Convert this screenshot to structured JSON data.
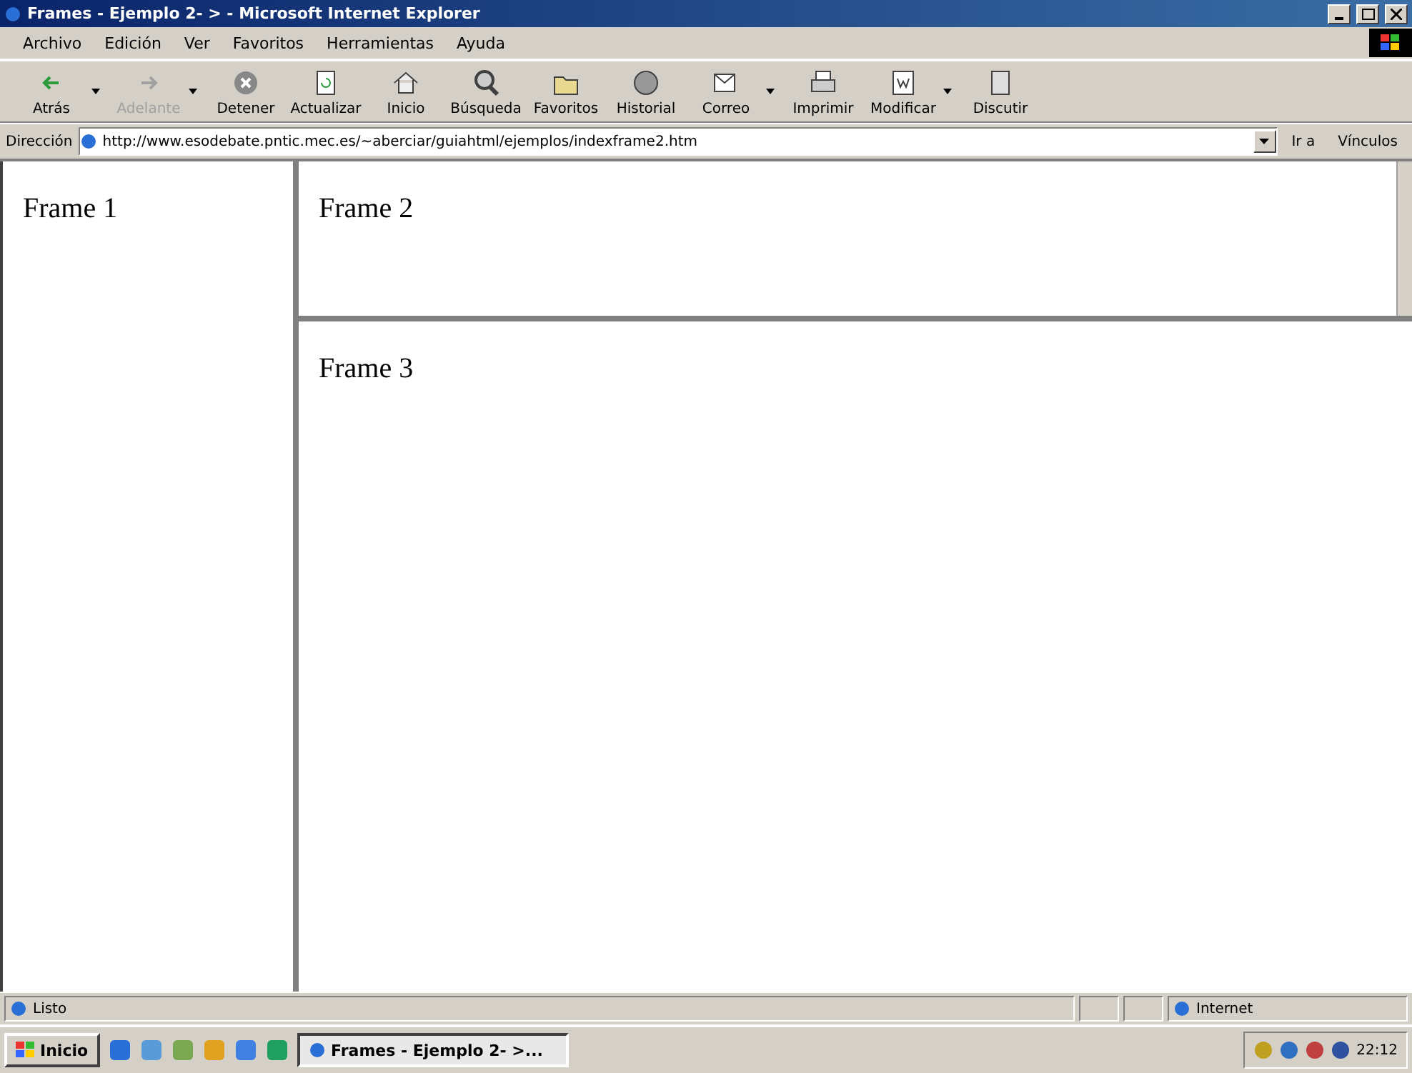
{
  "window": {
    "title": "Frames - Ejemplo 2- > - Microsoft Internet Explorer"
  },
  "menu": [
    "Archivo",
    "Edición",
    "Ver",
    "Favoritos",
    "Herramientas",
    "Ayuda"
  ],
  "toolbar": [
    {
      "label": "Atrás",
      "kind": "back",
      "disabled": false,
      "dropdown": true
    },
    {
      "label": "Adelante",
      "kind": "forward",
      "disabled": true,
      "dropdown": true
    },
    {
      "label": "Detener",
      "kind": "stop",
      "disabled": false,
      "dropdown": false
    },
    {
      "label": "Actualizar",
      "kind": "refresh",
      "disabled": false,
      "dropdown": false
    },
    {
      "label": "Inicio",
      "kind": "home",
      "disabled": false,
      "dropdown": false
    },
    {
      "label": "Búsqueda",
      "kind": "search",
      "disabled": false,
      "dropdown": false
    },
    {
      "label": "Favoritos",
      "kind": "favorites",
      "disabled": false,
      "dropdown": false
    },
    {
      "label": "Historial",
      "kind": "history",
      "disabled": false,
      "dropdown": false
    },
    {
      "label": "Correo",
      "kind": "mail",
      "disabled": false,
      "dropdown": true
    },
    {
      "label": "Imprimir",
      "kind": "print",
      "disabled": false,
      "dropdown": false
    },
    {
      "label": "Modificar",
      "kind": "edit",
      "disabled": false,
      "dropdown": true
    },
    {
      "label": "Discutir",
      "kind": "discuss",
      "disabled": false,
      "dropdown": false
    }
  ],
  "address": {
    "label": "Dirección",
    "value": "http://www.esodebate.pntic.mec.es/~aberciar/guiahtml/ejemplos/indexframe2.htm",
    "go": "Ir a",
    "links": "Vínculos"
  },
  "frames": [
    {
      "text": "Frame 1"
    },
    {
      "text": "Frame 2"
    },
    {
      "text": "Frame 3"
    }
  ],
  "status_bar": {
    "text": "Listo",
    "zone": "Internet"
  },
  "taskbar": {
    "start": "Inicio",
    "task": "Frames - Ejemplo 2- >...",
    "clock": "22:12"
  }
}
